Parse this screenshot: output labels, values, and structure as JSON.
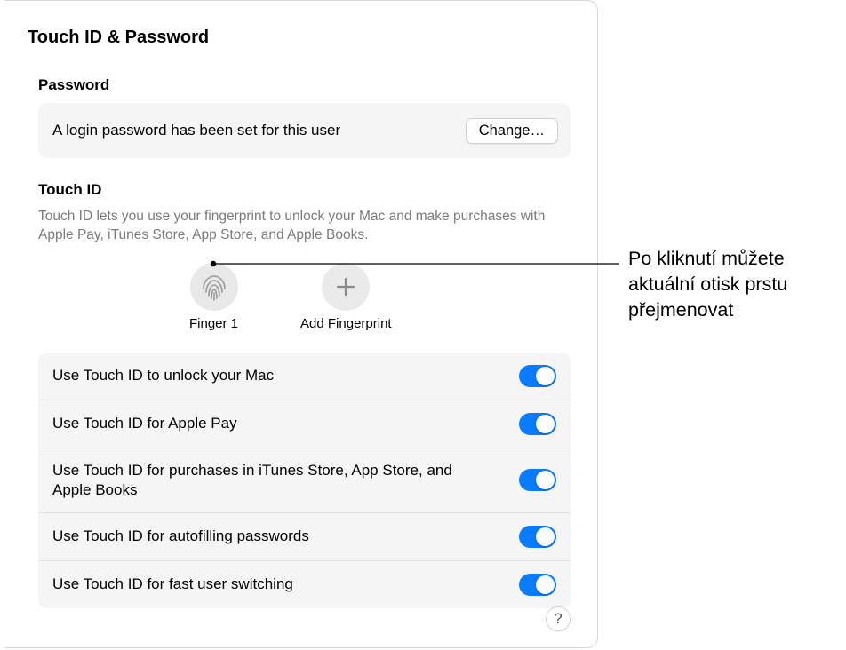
{
  "panelTitle": "Touch ID & Password",
  "password": {
    "sectionLabel": "Password",
    "statusText": "A login password has been set for this user",
    "changeButton": "Change…"
  },
  "touchId": {
    "sectionLabel": "Touch ID",
    "description": "Touch ID lets you use your fingerprint to unlock your Mac and make purchases with Apple Pay, iTunes Store, App Store, and Apple Books.",
    "fingerprints": {
      "existingLabel": "Finger 1",
      "addLabel": "Add Fingerprint"
    },
    "options": [
      {
        "label": "Use Touch ID to unlock your Mac",
        "on": true
      },
      {
        "label": "Use Touch ID for Apple Pay",
        "on": true
      },
      {
        "label": "Use Touch ID for purchases in iTunes Store, App Store, and Apple Books",
        "on": true
      },
      {
        "label": "Use Touch ID for autofilling passwords",
        "on": true
      },
      {
        "label": "Use Touch ID for fast user switching",
        "on": true
      }
    ]
  },
  "helpGlyph": "?",
  "callout": "Po kliknutí můžete aktuální otisk prstu přejmenovat"
}
